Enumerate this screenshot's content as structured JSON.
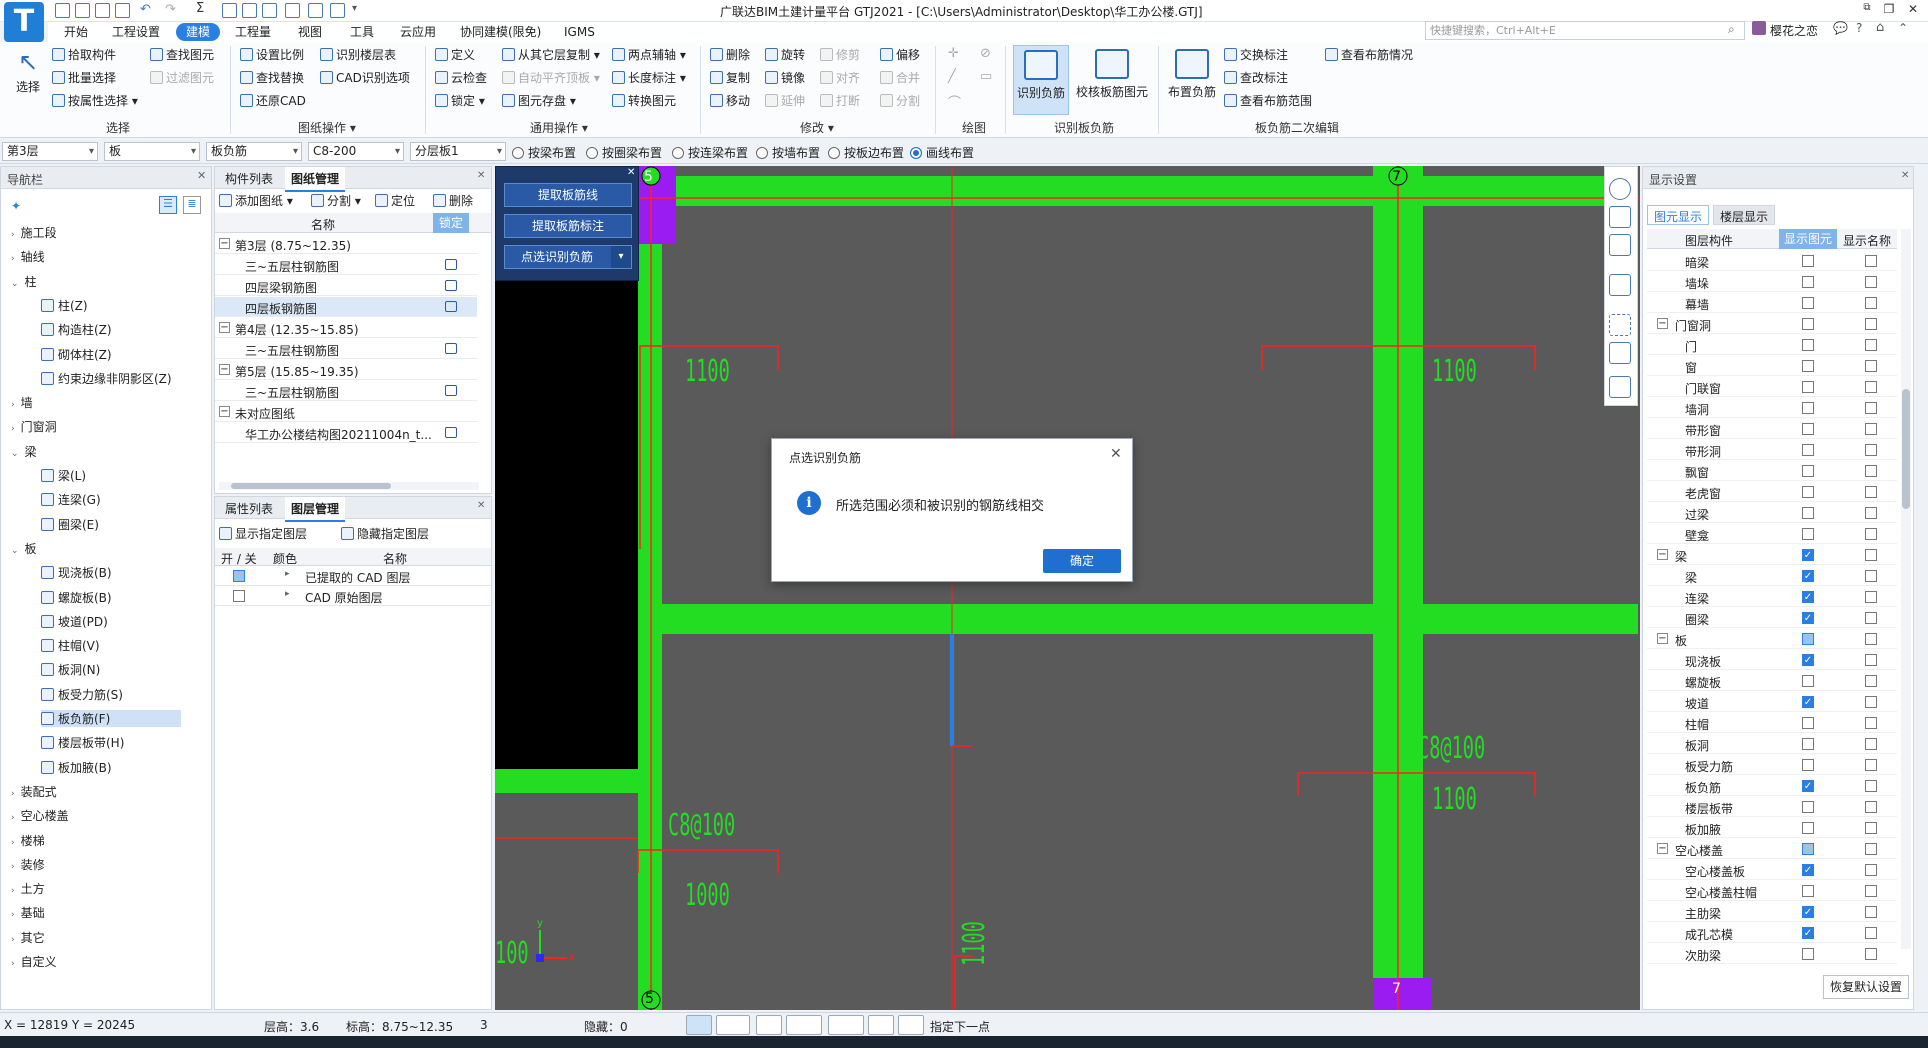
{
  "app": {
    "title": "广联达BIM土建计量平台 GTJ2021 - [C:\\Users\\Administrator\\Desktop\\华工办公楼.GTJ]",
    "logo": "T",
    "user": "樱花之恋",
    "search_placeholder": "快捷键搜索，Ctrl+Alt+E"
  },
  "menu": [
    "开始",
    "工程设置",
    "建模",
    "工程量",
    "视图",
    "工具",
    "云应用",
    "协同建模(限免)",
    "IGMS"
  ],
  "ribbon": {
    "select": {
      "big": "选择",
      "items": [
        "拾取构件",
        "批量选择",
        "按属性选择"
      ],
      "group": "选择"
    },
    "col2": [
      "查找图元",
      "过滤图元"
    ],
    "drawing": {
      "items": [
        "设置比例",
        "识别楼层表",
        "查找替换",
        "CAD识别选项",
        "还原CAD"
      ],
      "group": "图纸操作"
    },
    "general": {
      "items": [
        "定义",
        "从其它层复制",
        "两点辅轴",
        "云检查",
        "自动平齐顶板",
        "长度标注",
        "锁定",
        "图元存盘",
        "转换图元"
      ],
      "group": "通用操作"
    },
    "modify": {
      "items": [
        "删除",
        "旋转",
        "修剪",
        "偏移",
        "复制",
        "镜像",
        "对齐",
        "合并",
        "移动",
        "延伸",
        "打断",
        "分割"
      ],
      "group": "修改"
    },
    "draw_group": "绘图",
    "identify": {
      "big1": "识别负筋",
      "big2": "校核板筋图元",
      "group": "识别板负筋"
    },
    "secondary": {
      "big": "布置负筋",
      "items": [
        "交换标注",
        "查看布筋情况",
        "查改标注",
        "查看布筋范围"
      ],
      "group": "板负筋二次编辑"
    }
  },
  "propbar": {
    "floor": "第3层",
    "type": "板",
    "component": "板负筋",
    "spec": "C8-200",
    "layer": "分层板1",
    "modes": [
      "按梁布置",
      "按圈梁布置",
      "按连梁布置",
      "按墙布置",
      "按板边布置",
      "画线布置"
    ],
    "selected_mode": "画线布置"
  },
  "nav": {
    "title": "导航栏",
    "items": [
      {
        "label": "施工段",
        "level": 0,
        "caret": "›"
      },
      {
        "label": "轴线",
        "level": 0,
        "caret": "›"
      },
      {
        "label": "柱",
        "level": 0,
        "caret": "⌄"
      },
      {
        "label": "柱(Z)",
        "level": 1
      },
      {
        "label": "构造柱(Z)",
        "level": 1
      },
      {
        "label": "砌体柱(Z)",
        "level": 1
      },
      {
        "label": "约束边缘非阴影区(Z)",
        "level": 1
      },
      {
        "label": "墙",
        "level": 0,
        "caret": "›"
      },
      {
        "label": "门窗洞",
        "level": 0,
        "caret": "›"
      },
      {
        "label": "梁",
        "level": 0,
        "caret": "⌄"
      },
      {
        "label": "梁(L)",
        "level": 1
      },
      {
        "label": "连梁(G)",
        "level": 1
      },
      {
        "label": "圈梁(E)",
        "level": 1
      },
      {
        "label": "板",
        "level": 0,
        "caret": "⌄"
      },
      {
        "label": "现浇板(B)",
        "level": 1
      },
      {
        "label": "螺旋板(B)",
        "level": 1
      },
      {
        "label": "坡道(PD)",
        "level": 1
      },
      {
        "label": "柱帽(V)",
        "level": 1
      },
      {
        "label": "板洞(N)",
        "level": 1
      },
      {
        "label": "板受力筋(S)",
        "level": 1
      },
      {
        "label": "板负筋(F)",
        "level": 1,
        "selected": true
      },
      {
        "label": "楼层板带(H)",
        "level": 1
      },
      {
        "label": "板加腋(B)",
        "level": 1
      },
      {
        "label": "装配式",
        "level": 0,
        "caret": "›"
      },
      {
        "label": "空心楼盖",
        "level": 0,
        "caret": "›"
      },
      {
        "label": "楼梯",
        "level": 0,
        "caret": "›"
      },
      {
        "label": "装修",
        "level": 0,
        "caret": "›"
      },
      {
        "label": "土方",
        "level": 0,
        "caret": "›"
      },
      {
        "label": "基础",
        "level": 0,
        "caret": "›"
      },
      {
        "label": "其它",
        "level": 0,
        "caret": "›"
      },
      {
        "label": "自定义",
        "level": 0,
        "caret": "›"
      }
    ]
  },
  "drawings": {
    "tabs": [
      "构件列表",
      "图纸管理"
    ],
    "active_tab": "图纸管理",
    "toolbar": [
      "添加图纸",
      "分割",
      "定位",
      "删除"
    ],
    "col_name": "名称",
    "col_lock": "锁定",
    "rows": [
      {
        "label": "第3层 (8.75~12.35)",
        "group": true
      },
      {
        "label": "三~五层柱钢筋图"
      },
      {
        "label": "四层梁钢筋图"
      },
      {
        "label": "四层板钢筋图",
        "selected": true
      },
      {
        "label": "第4层 (12.35~15.85)",
        "group": true
      },
      {
        "label": "三~五层柱钢筋图"
      },
      {
        "label": "第5层 (15.85~19.35)",
        "group": true
      },
      {
        "label": "三~五层柱钢筋图"
      },
      {
        "label": "未对应图纸",
        "group": true
      },
      {
        "label": "华工办公楼结构图20211004n_t..."
      }
    ]
  },
  "layers": {
    "tabs": [
      "属性列表",
      "图层管理"
    ],
    "active_tab": "图层管理",
    "toolbar": [
      "显示指定图层",
      "隐藏指定图层"
    ],
    "cols": [
      "开 / 关",
      "颜色",
      "名称"
    ],
    "rows": [
      {
        "name": "已提取的 CAD 图层",
        "on": true
      },
      {
        "name": "CAD 原始图层",
        "on": false
      }
    ]
  },
  "float_tool": [
    "提取板筋线",
    "提取板筋标注",
    "点选识别负筋"
  ],
  "canvas": {
    "axis_labels": [
      "5",
      "7",
      "5",
      "7"
    ],
    "dims": [
      "1100",
      "1100",
      "C8@100",
      "1100",
      "C8@100",
      "1000",
      "1100",
      "100"
    ],
    "axis_x": "x",
    "axis_y": "y"
  },
  "dialog": {
    "title": "点选识别负筋",
    "message": "所选范围必须和被识别的钢筋线相交",
    "ok": "确定"
  },
  "display": {
    "title": "显示设置",
    "tabs": [
      "图元显示",
      "楼层显示"
    ],
    "cols": [
      "图层构件",
      "显示图元",
      "显示名称"
    ],
    "rows": [
      {
        "label": "暗梁",
        "level": 1,
        "show": false,
        "name": false
      },
      {
        "label": "墙垛",
        "level": 1,
        "show": false,
        "name": false
      },
      {
        "label": "幕墙",
        "level": 1,
        "show": false,
        "name": false
      },
      {
        "label": "门窗洞",
        "level": 0,
        "show": false,
        "name": false
      },
      {
        "label": "门",
        "level": 1,
        "show": false,
        "name": false
      },
      {
        "label": "窗",
        "level": 1,
        "show": false,
        "name": false
      },
      {
        "label": "门联窗",
        "level": 1,
        "show": false,
        "name": false
      },
      {
        "label": "墙洞",
        "level": 1,
        "show": false,
        "name": false
      },
      {
        "label": "带形窗",
        "level": 1,
        "show": false,
        "name": false
      },
      {
        "label": "带形洞",
        "level": 1,
        "show": false,
        "name": false
      },
      {
        "label": "飘窗",
        "level": 1,
        "show": false,
        "name": false
      },
      {
        "label": "老虎窗",
        "level": 1,
        "show": false,
        "name": false
      },
      {
        "label": "过梁",
        "level": 1,
        "show": false,
        "name": false
      },
      {
        "label": "壁龛",
        "level": 1,
        "show": false,
        "name": false
      },
      {
        "label": "梁",
        "level": 0,
        "show": true,
        "name": false
      },
      {
        "label": "梁",
        "level": 1,
        "show": true,
        "name": false
      },
      {
        "label": "连梁",
        "level": 1,
        "show": true,
        "name": false
      },
      {
        "label": "圈梁",
        "level": 1,
        "show": true,
        "name": false
      },
      {
        "label": "板",
        "level": 0,
        "show": "part",
        "name": false
      },
      {
        "label": "现浇板",
        "level": 1,
        "show": true,
        "name": false
      },
      {
        "label": "螺旋板",
        "level": 1,
        "show": false,
        "name": false
      },
      {
        "label": "坡道",
        "level": 1,
        "show": true,
        "name": false
      },
      {
        "label": "柱帽",
        "level": 1,
        "show": false,
        "name": false
      },
      {
        "label": "板洞",
        "level": 1,
        "show": false,
        "name": false
      },
      {
        "label": "板受力筋",
        "level": 1,
        "show": false,
        "name": false
      },
      {
        "label": "板负筋",
        "level": 1,
        "show": true,
        "name": false
      },
      {
        "label": "楼层板带",
        "level": 1,
        "show": false,
        "name": false
      },
      {
        "label": "板加腋",
        "level": 1,
        "show": false,
        "name": false
      },
      {
        "label": "空心楼盖",
        "level": 0,
        "show": "part",
        "name": false
      },
      {
        "label": "空心楼盖板",
        "level": 1,
        "show": true,
        "name": false
      },
      {
        "label": "空心楼盖柱帽",
        "level": 1,
        "show": false,
        "name": false
      },
      {
        "label": "主肋梁",
        "level": 1,
        "show": true,
        "name": false
      },
      {
        "label": "成孔芯模",
        "level": 1,
        "show": true,
        "name": false
      },
      {
        "label": "次肋梁",
        "level": 1,
        "show": false,
        "name": false
      }
    ],
    "restore": "恢复默认设置"
  },
  "status": {
    "coords": "X = 12819 Y = 20245",
    "floor_height_label": "层高：",
    "floor_height": "3.6",
    "elev_label": "标高：",
    "elev": "8.75~12.35",
    "count": "3",
    "hidden_label": "隐藏：",
    "hidden": "0",
    "hint": "指定下一点"
  },
  "colors": {
    "accent": "#2a7fe2",
    "beam": "#22dd22",
    "axis": "#ff2020",
    "column": "#8a2be2",
    "canvas": "#5a5a5a"
  }
}
